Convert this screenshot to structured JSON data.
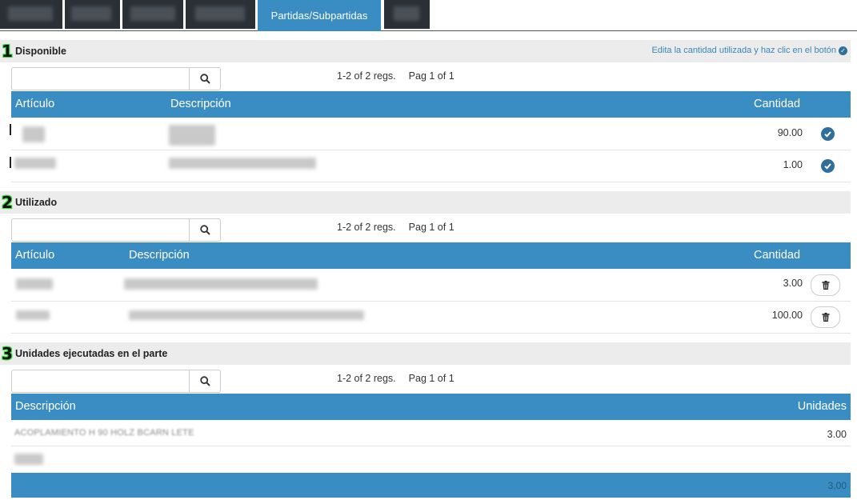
{
  "tabs": {
    "active_label": "Partidas/Subpartidas"
  },
  "sections": {
    "disponible": {
      "number": "1",
      "title": "Disponible",
      "hint": "Edita la cantidad utilizada y haz clic en el botón",
      "search_placeholder": "",
      "pager_regs": "1-2 of 2 regs.",
      "pager_page": "Pag 1 of 1",
      "columns": {
        "articulo": "Artículo",
        "descripcion": "Descripción",
        "cantidad": "Cantidad"
      },
      "rows": [
        {
          "cantidad": "90.00",
          "action_icon": "check-circle-icon"
        },
        {
          "cantidad": "1.00",
          "action_icon": "check-circle-icon"
        }
      ]
    },
    "utilizado": {
      "number": "2",
      "title": "Utilizado",
      "search_placeholder": "",
      "pager_regs": "1-2 of 2 regs.",
      "pager_page": "Pag 1 of 1",
      "columns": {
        "articulo": "Artículo",
        "descripcion": "Descripción",
        "cantidad": "Cantidad"
      },
      "rows": [
        {
          "cantidad": "3.00",
          "action_icon": "trash-icon"
        },
        {
          "cantidad": "100.00",
          "action_icon": "trash-icon"
        }
      ]
    },
    "unidades": {
      "number": "3",
      "title": "Unidades ejecutadas en el parte",
      "search_placeholder": "",
      "pager_regs": "1-2 of 2 regs.",
      "pager_page": "Pag 1 of 1",
      "columns": {
        "descripcion": "Descripción",
        "unidades": "Unidades"
      },
      "rows": [
        {
          "descripcion": "ACOPLAMIENTO H 90 HOLZ BCARN LETE",
          "unidades": "3.00"
        },
        {
          "descripcion": "",
          "unidades": ""
        }
      ],
      "footer_total": "3,00"
    }
  },
  "colors": {
    "accent": "#3a8dc3",
    "section_bg": "#ececec",
    "number_outline": "#3cd43c",
    "action_icon": "#2f6f9a"
  }
}
